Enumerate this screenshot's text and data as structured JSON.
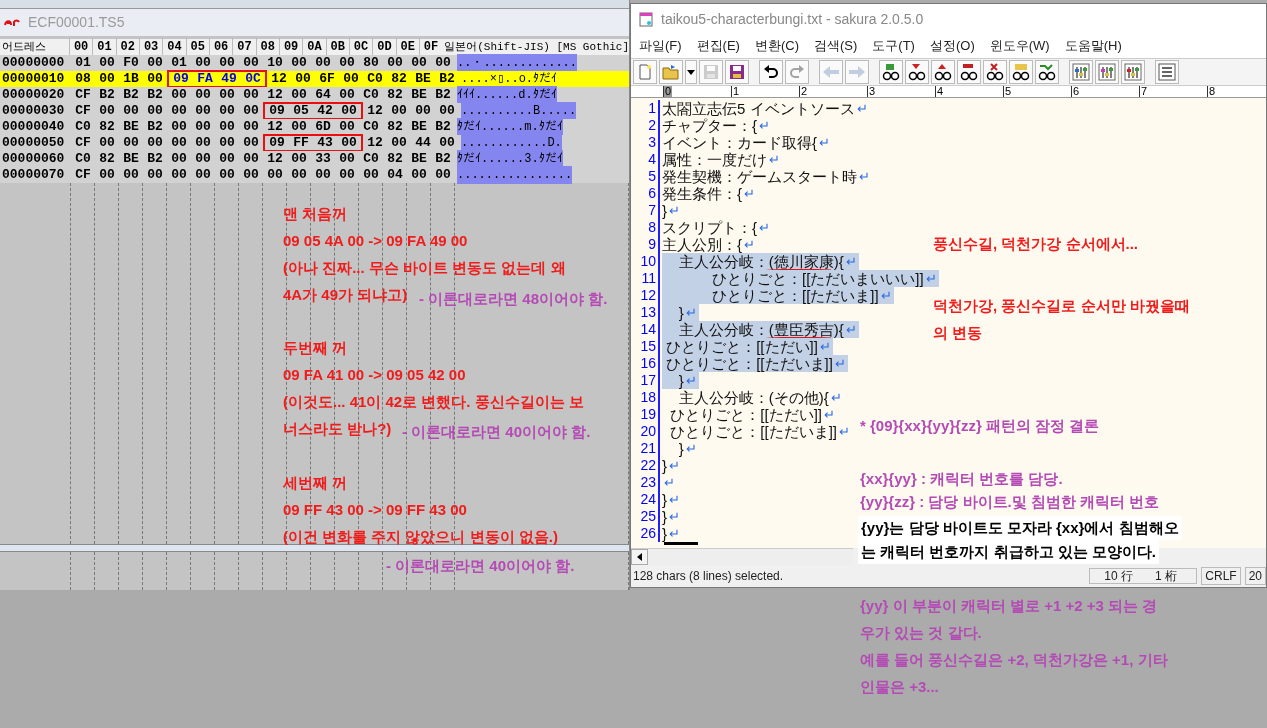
{
  "hex_window": {
    "title": "ECF00001.TS5",
    "header": {
      "address": "어드레스",
      "columns": [
        "00",
        "01",
        "02",
        "03",
        "04",
        "05",
        "06",
        "07",
        "08",
        "09",
        "0A",
        "0B",
        "0C",
        "0D",
        "0E",
        "0F"
      ],
      "text": "일본어(Shift-JIS) [MS Gothic]"
    },
    "rows": [
      {
        "address": "00000000",
        "selected": false,
        "ascii": "..・.............",
        "segments": [
          {
            "boxed": false,
            "selected": false,
            "bytes": [
              "01",
              "00",
              "F0",
              "00",
              "01",
              "00",
              "00",
              "00",
              "10",
              "00",
              "00",
              "00",
              "80",
              "00",
              "00",
              "00"
            ]
          }
        ]
      },
      {
        "address": "00000010",
        "selected": true,
        "ascii": "....×▯..o.ﾀだｲ",
        "segments": [
          {
            "boxed": false,
            "selected": false,
            "bytes": [
              "08",
              "00",
              "1B",
              "00"
            ]
          },
          {
            "boxed": true,
            "selected": true,
            "bytes": [
              "09",
              "FA",
              "49",
              "0C"
            ]
          },
          {
            "boxed": false,
            "selected": false,
            "bytes": [
              "12",
              "00",
              "6F",
              "00",
              "C0",
              "82",
              "BE",
              "B2"
            ]
          }
        ]
      },
      {
        "address": "00000020",
        "selected": false,
        "ascii": "ｲｲｲ......d.ﾀだｲ",
        "segments": [
          {
            "boxed": false,
            "selected": false,
            "bytes": [
              "CF",
              "B2",
              "B2",
              "B2",
              "00",
              "00",
              "00",
              "00",
              "12",
              "00",
              "64",
              "00",
              "C0",
              "82",
              "BE",
              "B2"
            ]
          }
        ]
      },
      {
        "address": "00000030",
        "selected": false,
        "ascii": "..........B.....",
        "segments": [
          {
            "boxed": false,
            "selected": false,
            "bytes": [
              "CF",
              "00",
              "00",
              "00",
              "00",
              "00",
              "00",
              "00"
            ]
          },
          {
            "boxed": true,
            "selected": false,
            "bytes": [
              "09",
              "05",
              "42",
              "00"
            ]
          },
          {
            "boxed": false,
            "selected": false,
            "bytes": [
              "12",
              "00",
              "00",
              "00"
            ]
          }
        ]
      },
      {
        "address": "00000040",
        "selected": false,
        "ascii": "ﾀだｲ......m.ﾀだｲ",
        "segments": [
          {
            "boxed": false,
            "selected": false,
            "bytes": [
              "C0",
              "82",
              "BE",
              "B2",
              "00",
              "00",
              "00",
              "00",
              "12",
              "00",
              "6D",
              "00",
              "C0",
              "82",
              "BE",
              "B2"
            ]
          }
        ]
      },
      {
        "address": "00000050",
        "selected": false,
        "ascii": "............D.",
        "segments": [
          {
            "boxed": false,
            "selected": false,
            "bytes": [
              "CF",
              "00",
              "00",
              "00",
              "00",
              "00",
              "00",
              "00"
            ]
          },
          {
            "boxed": true,
            "selected": false,
            "bytes": [
              "09",
              "FF",
              "43",
              "00"
            ]
          },
          {
            "boxed": false,
            "selected": false,
            "bytes": [
              "12",
              "00",
              "44",
              "00"
            ]
          }
        ]
      },
      {
        "address": "00000060",
        "selected": false,
        "ascii": "ﾀだｲ......3.ﾀだｲ",
        "segments": [
          {
            "boxed": false,
            "selected": false,
            "bytes": [
              "C0",
              "82",
              "BE",
              "B2",
              "00",
              "00",
              "00",
              "00",
              "12",
              "00",
              "33",
              "00",
              "C0",
              "82",
              "BE",
              "B2"
            ]
          }
        ]
      },
      {
        "address": "00000070",
        "selected": false,
        "ascii": "................",
        "segments": [
          {
            "boxed": false,
            "selected": false,
            "bytes": [
              "CF",
              "00",
              "00",
              "00",
              "00",
              "00",
              "00",
              "00",
              "00",
              "00",
              "00",
              "00",
              "00",
              "04",
              "00",
              "00"
            ]
          }
        ]
      }
    ]
  },
  "editor_window": {
    "title": "taikou5-characterbungi.txt - sakura 2.0.5.0",
    "menu": [
      "파일(F)",
      "편집(E)",
      "변환(C)",
      "검색(S)",
      "도구(T)",
      "설정(O)",
      "윈도우(W)",
      "도움말(H)"
    ],
    "toolbar": [
      {
        "buttons": [
          {
            "kind": "new",
            "disabled": false
          },
          {
            "kind": "open",
            "disabled": false
          },
          {
            "kind": "dropdown",
            "disabled": false
          },
          {
            "kind": "save",
            "disabled": true
          },
          {
            "kind": "save-all",
            "disabled": false
          }
        ]
      },
      {
        "buttons": [
          {
            "kind": "undo",
            "disabled": false
          },
          {
            "kind": "redo",
            "disabled": true
          }
        ]
      },
      {
        "buttons": [
          {
            "kind": "back",
            "disabled": true
          },
          {
            "kind": "forward",
            "disabled": true
          }
        ]
      },
      {
        "buttons": [
          {
            "kind": "search",
            "disabled": false
          },
          {
            "kind": "search-down",
            "disabled": false
          },
          {
            "kind": "search-up",
            "disabled": false
          },
          {
            "kind": "replace",
            "disabled": false
          },
          {
            "kind": "clear",
            "disabled": false
          },
          {
            "kind": "grep",
            "disabled": false
          },
          {
            "kind": "jump",
            "disabled": false
          }
        ]
      },
      {
        "buttons": [
          {
            "kind": "settings",
            "disabled": false
          },
          {
            "kind": "type-settings",
            "disabled": false
          },
          {
            "kind": "common-settings",
            "disabled": false
          }
        ]
      },
      {
        "buttons": [
          {
            "kind": "outline",
            "disabled": false
          }
        ]
      }
    ],
    "ruler": [
      "0",
      "1",
      "2",
      "3",
      "4",
      "5",
      "6",
      "7",
      "8"
    ],
    "lines": [
      {
        "number": "1",
        "text": "太閤立志伝5 イベントソース",
        "eol": "↵",
        "selected": false
      },
      {
        "number": "2",
        "text": "チャプター：{",
        "eol": "↵",
        "selected": false
      },
      {
        "number": "3",
        "text": "イベント：カード取得{",
        "eol": "↵",
        "selected": false
      },
      {
        "number": "4",
        "text": "属性：一度だけ",
        "eol": "↵",
        "selected": false
      },
      {
        "number": "5",
        "text": "発生契機：ゲームスタート時",
        "eol": "↵",
        "selected": false
      },
      {
        "number": "6",
        "text": "発生条件：{",
        "eol": "↵",
        "selected": false
      },
      {
        "number": "7",
        "text": "}",
        "eol": "↵",
        "selected": false
      },
      {
        "number": "8",
        "text": "スクリプト：{",
        "eol": "↵",
        "selected": false
      },
      {
        "number": "9",
        "text": "主人公別：{",
        "eol": "↵",
        "selected": false
      },
      {
        "number": "10",
        "text": "    主人公分岐：(徳川家康){",
        "eol": "↵",
        "selected": true,
        "underlined": true
      },
      {
        "number": "11",
        "text": "            ひとりごと：[[ただいまいいい]]",
        "eol": "↵",
        "selected": true
      },
      {
        "number": "12",
        "text": "            ひとりごと：[[ただいま]]",
        "eol": "↵",
        "selected": true
      },
      {
        "number": "13",
        "text": "    }",
        "eol": "↵",
        "selected": true
      },
      {
        "number": "14",
        "text": "    主人公分岐：(豊臣秀吉){",
        "eol": "↵",
        "selected": true,
        "underlined": true
      },
      {
        "number": "15",
        "text": " ひとりごと：[[ただい]]",
        "eol": "↵",
        "selected": true
      },
      {
        "number": "16",
        "text": " ひとりごと：[[ただいま]]",
        "eol": "↵",
        "selected": true
      },
      {
        "number": "17",
        "text": "    }",
        "eol": "↵",
        "selected": true
      },
      {
        "number": "18",
        "text": "    主人公分岐：(その他){",
        "eol": "↵",
        "selected": false
      },
      {
        "number": "19",
        "text": "  ひとりごと：[[ただい]]",
        "eol": "↵",
        "selected": false
      },
      {
        "number": "20",
        "text": "  ひとりごと：[[ただいま]]",
        "eol": "↵",
        "selected": false
      },
      {
        "number": "21",
        "text": "    }",
        "eol": "↵",
        "selected": false
      },
      {
        "number": "22",
        "text": "}",
        "eol": "↵",
        "selected": false
      },
      {
        "number": "23",
        "eol": "↵",
        "selected": false
      },
      {
        "number": "24",
        "text": "}",
        "eol": "↵",
        "selected": false
      },
      {
        "number": "25",
        "text": "}",
        "eol": "↵",
        "selected": false
      },
      {
        "number": "26",
        "text": "}",
        "eol": "↵",
        "selected": false
      }
    ],
    "status": {
      "text": "128 chars (8 lines) selected.",
      "position": [
        "10 行",
        "1 桁"
      ],
      "fields": [
        "CRLF",
        "20"
      ]
    }
  },
  "notes": [
    {
      "kind": "plain",
      "color": "#f01c1c",
      "lines": [
        "맨 처음꺼",
        "09 05 4A 00 -> 09 FA 49 00",
        "(아나 진짜... 무슨 바이트 변동도 없는데 왜",
        "4A가 49가 되냐고)"
      ]
    },
    {
      "kind": "plain",
      "color": "#b44ab4",
      "lines": [
        "- 이론대로라면 48이어야 함."
      ]
    },
    {
      "kind": "plain",
      "color": "#f01c1c",
      "lines": [
        "두번째 꺼",
        "09 FA 41 00 -> 09 05 42 00",
        "(이것도... 41이 42로 변했다. 풍신수길이는 보",
        "너스라도 받나?)"
      ]
    },
    {
      "kind": "plain",
      "color": "#b44ab4",
      "lines": [
        "- 이론대로라면 40이어야 함."
      ]
    },
    {
      "kind": "plain",
      "color": "#f01c1c",
      "lines": [
        "세번째 꺼",
        "09 FF 43 00 -> 09 FF 43 00",
        "(이건 변화를 주지 않았으니 변동이 없음.)"
      ]
    },
    {
      "kind": "plain",
      "color": "#b44ab4",
      "lines": [
        "- 이론대로라면 40이어야 함."
      ]
    },
    {
      "kind": "plain",
      "color": "#f01c1c",
      "lines": [
        "풍신수길, 덕천가강 순서에서..."
      ]
    },
    {
      "kind": "plain",
      "color": "#f01c1c",
      "lines": [
        "덕천가강, 풍신수길로 순서만 바꿨을때",
        "의 변동"
      ]
    },
    {
      "kind": "plain",
      "color": "#b44ab4",
      "lines": [
        "* {09}{xx}{yy}{zz} 패턴의 잠정 결론"
      ]
    },
    {
      "kind": "plain",
      "color": "#b44ab4",
      "lines": [
        "{xx}{yy} : 캐릭터 번호를 담당.",
        "{yy}{zz} : 담당 바이트.및 침범한 캐릭터 번호"
      ]
    },
    {
      "kind": "callout",
      "color": "#000000",
      "lines": [
        "{yy}는 담당 바이트도 모자라 {xx}에서 침범해오",
        "는 캐릭터 번호까지 취급하고 있는 모양이다."
      ]
    },
    {
      "kind": "plain",
      "color": "#b44ab4",
      "lines": [
        "{yy} 이 부분이 캐릭터 별로 +1 +2 +3 되는 경",
        "우가 있는 것 같다.",
        "예를 들어 풍신수길은 +2, 덕천가강은 +1, 기타",
        "인물은 +3..."
      ]
    }
  ]
}
